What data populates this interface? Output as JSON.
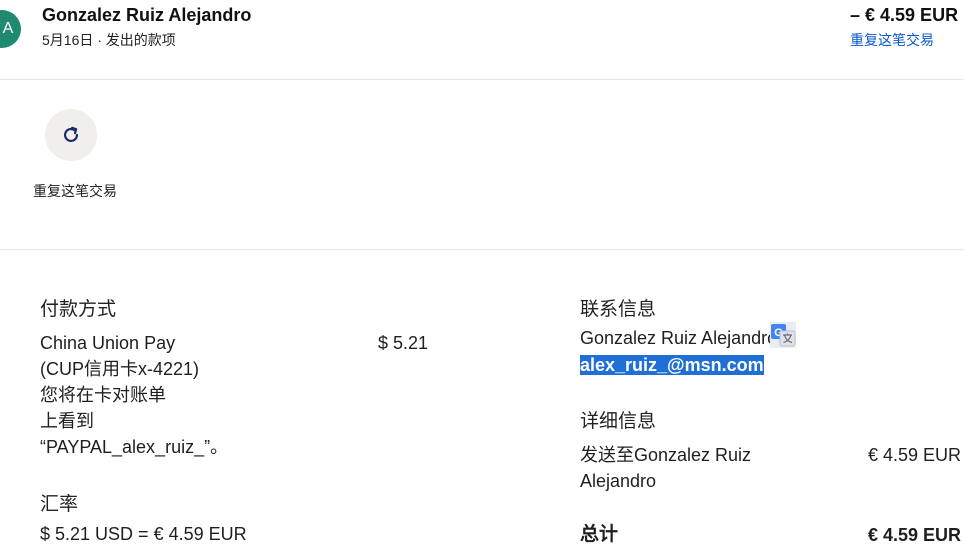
{
  "header": {
    "avatar_initial": "A",
    "merchant_name": "Gonzalez Ruiz Alejandro",
    "subline": "5月16日 · 发出的款项",
    "amount": "– € 4.59 EUR",
    "repeat_link": "重复这笔交易"
  },
  "action": {
    "icon": "refresh-icon",
    "label": "重复这笔交易"
  },
  "payment": {
    "heading": "付款方式",
    "method_lines": [
      "China Union Pay",
      "(CUP信用卡x-4221)",
      "您将在卡对账单",
      "上看到",
      "“PAYPAL_alex_ruiz_”。"
    ],
    "amount": "$ 5.21"
  },
  "exchange": {
    "heading": "汇率",
    "rate": "$ 5.21 USD = € 4.59 EUR"
  },
  "contact": {
    "heading": "联系信息",
    "name": "Gonzalez Ruiz Alejandro",
    "email": "alex_ruiz_@msn.com"
  },
  "details": {
    "heading": "详细信息",
    "sent_to_lines": [
      "发送至Gonzalez Ruiz",
      "Alejandro"
    ],
    "sent_amount": "€ 4.59 EUR",
    "total_label": "总计",
    "total_amount": "€ 4.59 EUR"
  },
  "colors": {
    "avatar": "#1f8a70",
    "link": "#0a58ca",
    "selection": "#1f6fd6"
  }
}
